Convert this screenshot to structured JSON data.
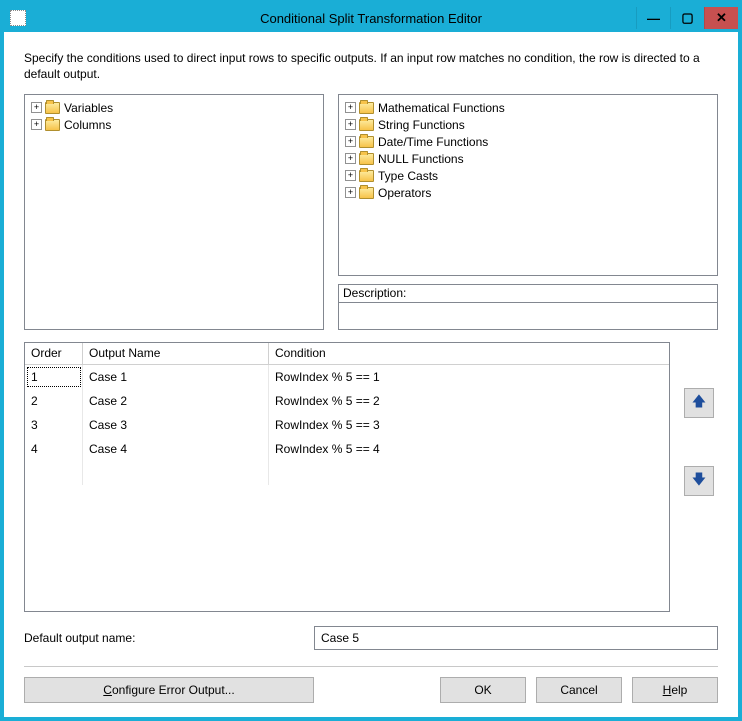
{
  "window": {
    "title": "Conditional Split Transformation Editor",
    "description": "Specify the conditions used to direct input rows to specific outputs. If an input row matches no condition, the row is directed to a default output."
  },
  "leftTree": {
    "items": [
      "Variables",
      "Columns"
    ]
  },
  "rightTree": {
    "items": [
      "Mathematical Functions",
      "String Functions",
      "Date/Time Functions",
      "NULL Functions",
      "Type Casts",
      "Operators"
    ]
  },
  "descriptionLabel": "Description:",
  "grid": {
    "headers": {
      "order": "Order",
      "name": "Output Name",
      "cond": "Condition"
    },
    "rows": [
      {
        "order": "1",
        "name": "Case 1",
        "cond": "RowIndex % 5 == 1"
      },
      {
        "order": "2",
        "name": "Case 2",
        "cond": "RowIndex % 5 == 2"
      },
      {
        "order": "3",
        "name": "Case 3",
        "cond": "RowIndex % 5 == 3"
      },
      {
        "order": "4",
        "name": "Case 4",
        "cond": "RowIndex % 5 == 4"
      }
    ]
  },
  "defaultOutput": {
    "label": "Default output name:",
    "value": "Case 5"
  },
  "buttons": {
    "configError": "Configure Error Output...",
    "ok": "OK",
    "cancel": "Cancel",
    "help": "Help"
  }
}
